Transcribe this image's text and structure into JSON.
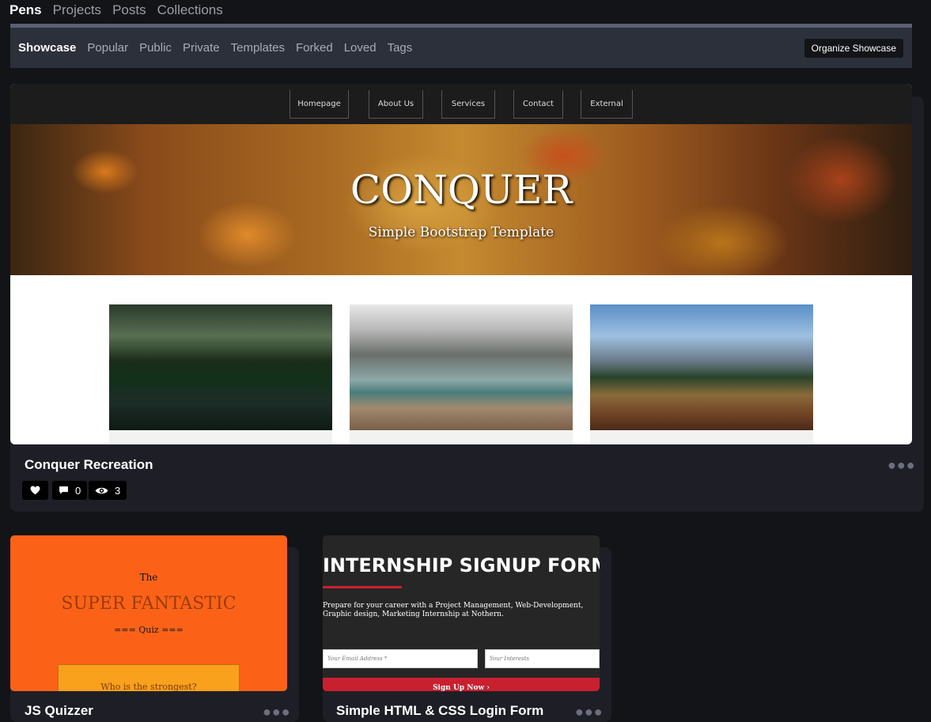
{
  "top_tabs": [
    "Pens",
    "Projects",
    "Posts",
    "Collections"
  ],
  "sub_tabs": [
    "Showcase",
    "Popular",
    "Public",
    "Private",
    "Templates",
    "Forked",
    "Loved",
    "Tags"
  ],
  "organize_label": "Organize Showcase",
  "main_pen": {
    "preview_nav": [
      "Homepage",
      "About Us",
      "Services",
      "Contact",
      "External"
    ],
    "hero_title": "CONQUER",
    "hero_subtitle": "Simple Bootstrap Template",
    "title": "Conquer Recreation",
    "comments": "0",
    "views": "3"
  },
  "quiz_pen": {
    "preview_the": "The",
    "preview_title": "SUPER FANTASTIC",
    "preview_sub": "=== Quiz ===",
    "preview_question": "Who is the strongest?",
    "title": "JS Quizzer"
  },
  "intern_pen": {
    "preview_title": "INTERNSHIP SIGNUP FORM",
    "preview_text": "Prepare for your career with a Project Management, Web-Development, Graphic design, Marketing Internship at Nothern.",
    "email_placeholder": "Your Email Address *",
    "interests_placeholder": "Your Interests",
    "button_label": "Sign Up Now ›",
    "title": "Simple HTML & CSS Login Form"
  },
  "colors": {
    "bg": "#131417",
    "card": "#1e1f26",
    "quiz_orange": "#fb6218",
    "intern_red": "#c8202f"
  }
}
